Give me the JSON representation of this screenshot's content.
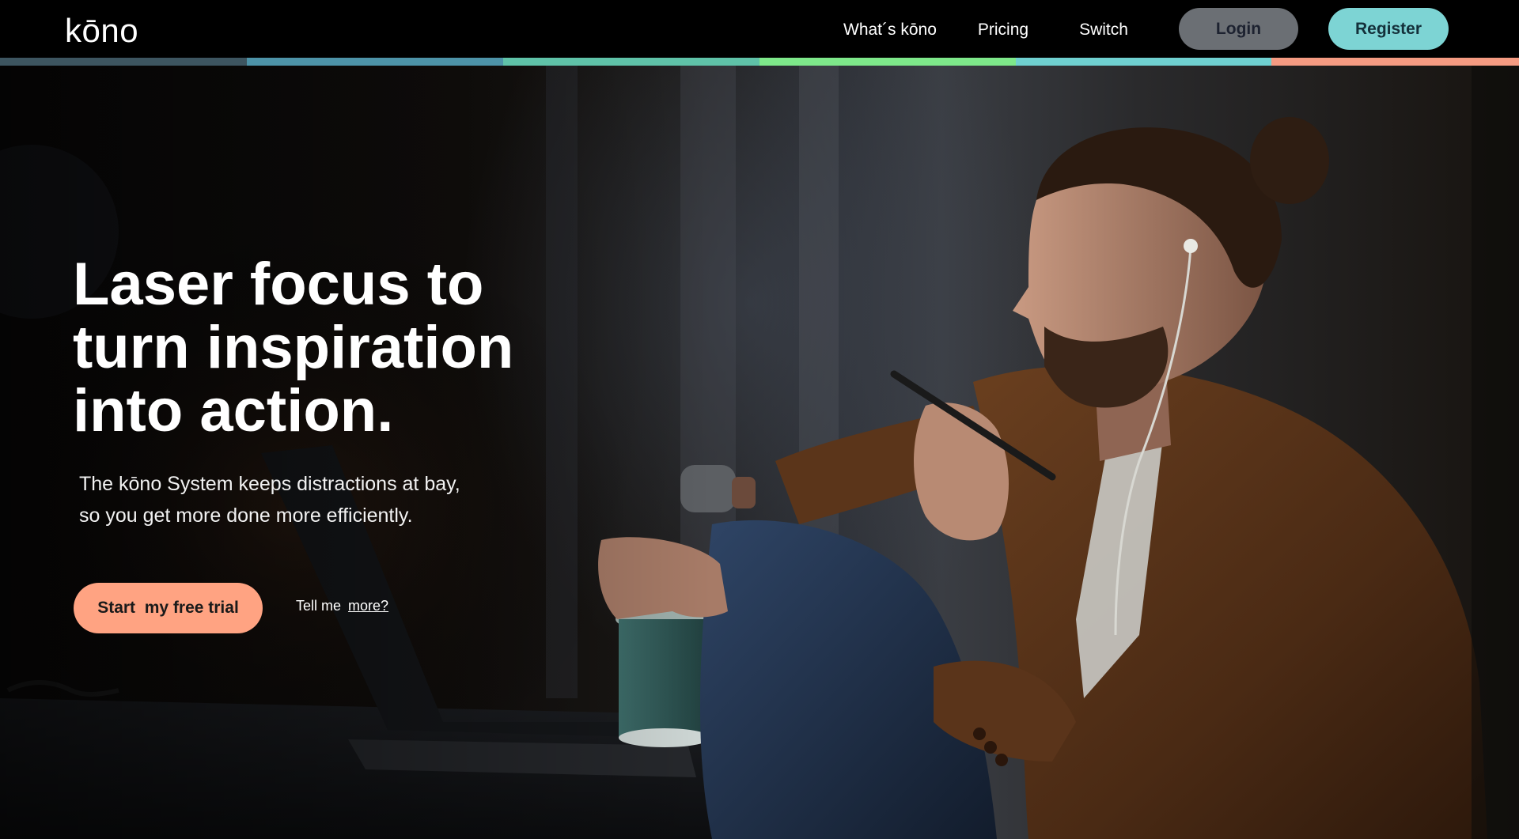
{
  "header": {
    "logo": "kōno",
    "nav": [
      {
        "label": "What´s kōno"
      },
      {
        "label": "Pricing"
      },
      {
        "label": "Switch"
      }
    ],
    "login_label": "Login",
    "register_label": "Register"
  },
  "color_strip": [
    "#3d5560",
    "#4d93a8",
    "#5fc2a8",
    "#7ee88a",
    "#6fd0d0",
    "#f59b82"
  ],
  "hero": {
    "headline_lines": [
      "Laser focus to",
      "turn inspiration",
      "into action."
    ],
    "subtext_lines": [
      "The kōno System keeps distractions at bay,",
      "so you get more done more efficiently."
    ],
    "cta_label": "Start  my free trial",
    "tell_me_prefix": "Tell me",
    "tell_me_link": "more?"
  },
  "colors": {
    "login_bg": "#6b6f74",
    "register_bg": "#7dd4d4",
    "cta_bg": "#ffa382"
  }
}
